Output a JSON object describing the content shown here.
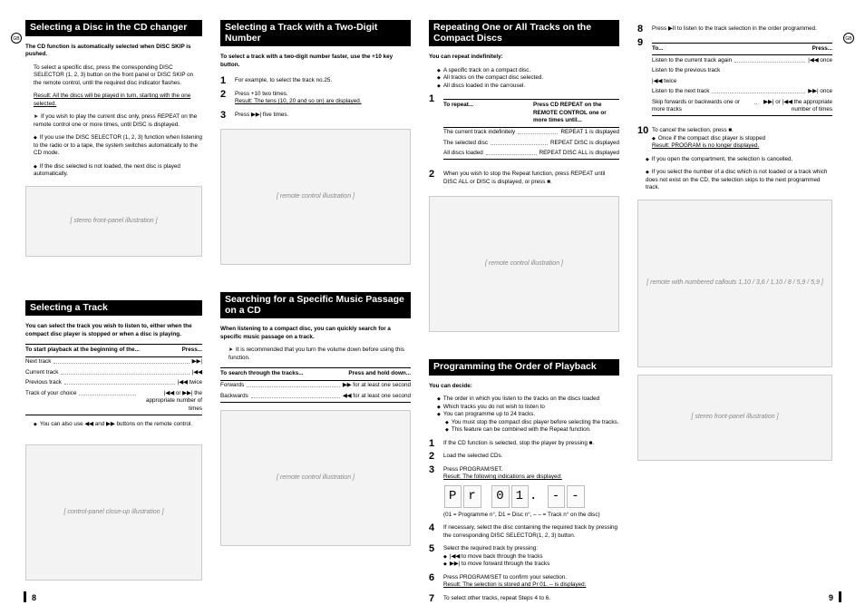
{
  "col1": {
    "h1": "Selecting a Disc in the CD changer",
    "intro": "The CD function is automatically selected when DISC SKIP is pushed.",
    "p1": "To select a specific disc, press the corresponding DISC SELECTOR (1, 2, 3) button on the front panel or DISC SKIP on the remote control, until the required disc indicator flashes.",
    "res1": "Result: All the discs will be played in turn, starting with the one selected.",
    "p2": "If you wish to play the current disc only, press REPEAT on the remote control one or more times, until DISC is displayed.",
    "b1": "If you use the DISC  SELECTOR (1, 2, 3) function when listening to the radio or to a tape, the system switches automatically to the CD mode.",
    "b2": "If the disc selected is not loaded, the next disc is played automatically.",
    "h2": "Selecting a Track",
    "p3": "You can select the track you wish to listen to, either when the compact disc player is stopped or when a disc is playing.",
    "tbl1head": "To start playback at the beginning of the...",
    "tbl1headR": "Press...",
    "t1r1": "Next track",
    "t1v1": "▶▶|",
    "t1r2": "Current track",
    "t1v2": "|◀◀",
    "t1r3": "Previous track",
    "t1v3": "|◀◀ twice",
    "t1r4": "Track of your choice",
    "t1v4": "|◀◀ or ▶▶| the appropriate number of times",
    "note1": "You can also use ◀◀ and ▶▶ buttons on the remote control."
  },
  "col2": {
    "h1": "Selecting a Track with a Two-Digit Number",
    "p1": "To select a track with a two-digit number faster, use the +10 key button.",
    "s1": "For example, to select the track no.25.",
    "s2": "Press +10 two times.",
    "s2r": "Result: The tens (10, 20 and so on) are displayed.",
    "s3": "Press ▶▶| five times.",
    "h2": "Searching for a Specific Music Passage on a CD",
    "p2": "When listening to a compact disc, you can quickly search for a specific music passage on a track.",
    "note1": "It is recommended that you turn the volume down before using this function.",
    "tblh": "To search through the tracks...",
    "tblhR": "Press and  hold down...",
    "r1": "Forwards",
    "v1": "▶▶ for at least one second",
    "r2": "Backwards",
    "v2": "◀◀ for at least one second"
  },
  "col3": {
    "h1": "Repeating One or All Tracks on the Compact Discs",
    "intro": "You can repeat indefinitely:",
    "b1": "A specific track on a compact disc.",
    "b2": "All tracks on the compact disc selected.",
    "b3": "All discs loaded in the carrousel.",
    "tblh": "To repeat...",
    "tblhR": "Press CD REPEAT on the REMOTE CONTROL one or more times until...",
    "r1": "The current track indefinitely",
    "v1": "REPEAT 1 is displayed",
    "r2": "The selected disc",
    "v2": "REPEAT DISC is displayed",
    "r3": "All discs loaded",
    "v3": "REPEAT DISC ALL is displayed",
    "s2": "When you wish to stop the Repeat function, press REPEAT until DISC ALL or DISC is displayed, or press ■.",
    "h2": "Programming the Order of Playback",
    "dec": "You can decide:",
    "d1": "The order in which you listen to the tracks on the discs loaded",
    "d2": "Which tracks you do not wish to listen to",
    "d3": "You can programme up to 24 tracks.",
    "d4": "You must stop the compact disc player before selecting the tracks.",
    "d5": "This feature can be combined with the Repeat function.",
    "o1": "If the CD function is selected, stop the player by pressing ■.",
    "o2": "Load the selected CDs.",
    "o3": "Press PROGRAM/SET.",
    "o3r": "Result:  The following indications are displayed:",
    "lcd": "Pr 01. --",
    "lcdnote": "(01 = Programme n°, D1 = Disc n°, – – = Track n° on the disc)",
    "o4": "If necessary, select the disc containing the required track by pressing the corresponding DISC SELECTOR(1, 2, 3) button.",
    "o5": "Select the required track by pressing:",
    "o5a": "|◀◀ to move back through the tracks",
    "o5b": "▶▶| to move forward through the tracks",
    "o6": "Press PROGRAM/SET to confirm your selection.",
    "o6r": "Result: The selection is stored and  Pr 01. --  is displayed.",
    "o7": "To select other tracks, repeat Steps 4 to 6."
  },
  "col4": {
    "s8": "Press  ▶II  to listen to the track selection in the order programmed.",
    "tblh": "To...",
    "tblhR": "Press...",
    "r1": "Listen to the current track again",
    "v1": "|◀◀ once",
    "r2": "Listen to the previous track",
    "v2": "",
    "r3": "|◀◀ twice",
    "v3": "",
    "r4": "Listen to the next track",
    "v4": "▶▶| once",
    "r5": "Skip forwards or backwards one or more tracks",
    "v5": "▶▶| or |◀◀ the appropriate number of times",
    "s10": "To cancel the selection, press ■.",
    "s10a": "Once if the compact disc player is stopped",
    "s10b": "Result: PROGRAM is no longer displayed.",
    "note": "If you open the compartment, the selection is cancelled.",
    "note2": "If you select the number of a disc which is not loaded or a track which does not exist on the CD, the selection skips to the next programmed track."
  },
  "pgL": "8",
  "pgR": "9"
}
